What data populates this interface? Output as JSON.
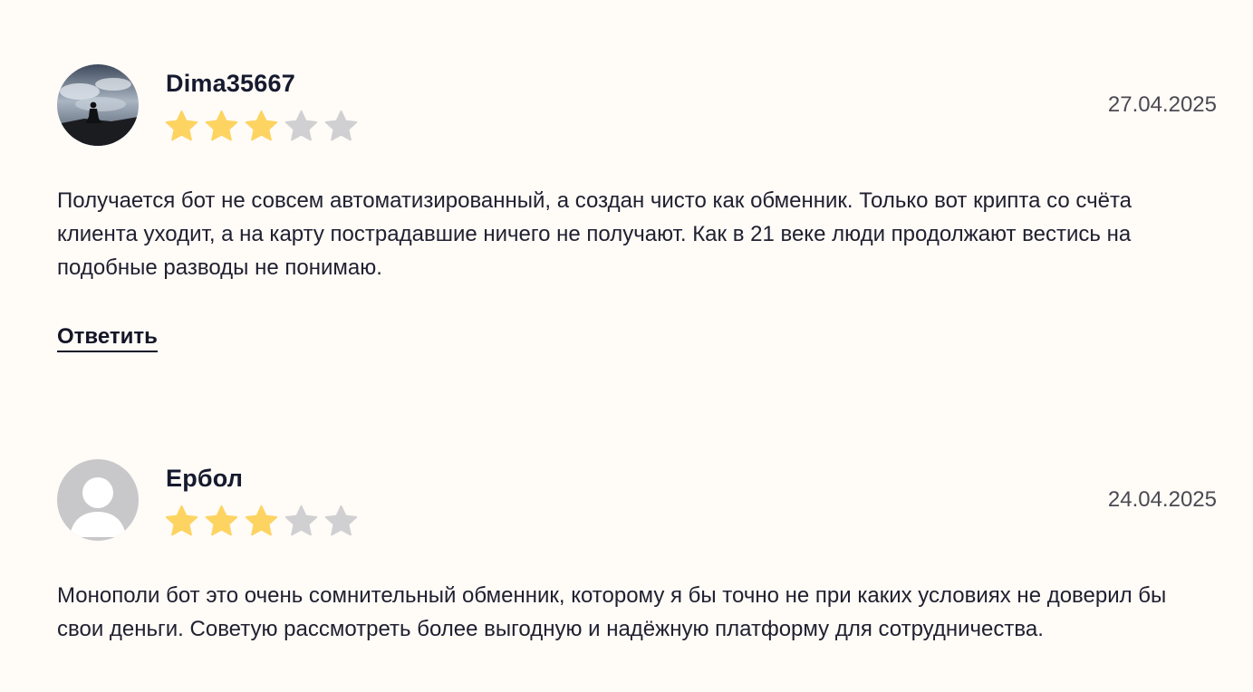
{
  "colors": {
    "background": "#fffbf7",
    "star_filled": "#fdd462",
    "star_empty": "#d0d0d2",
    "text": "#1c1c28"
  },
  "reviews": [
    {
      "author": "Dima35667",
      "rating": 3,
      "max_rating": 5,
      "date": "27.04.2025",
      "avatar_icon": "user-photo-silhouette",
      "text": "Получается бот не совсем автоматизированный, а создан чисто как обменник. Только вот крипта со счёта клиента уходит, а на карту пострадавшие ничего не получают. Как в 21 веке люди продолжают вестись на подобные разводы не понимаю.",
      "reply_label": "Ответить"
    },
    {
      "author": "Ербол",
      "rating": 3,
      "max_rating": 5,
      "date": "24.04.2025",
      "avatar_icon": "default-user-icon",
      "text": "Монополи бот это очень сомнительный обменник, которому я бы точно не при каких условиях не доверил бы свои деньги. Советую рассмотреть более выгодную и надёжную платформу для сотрудничества."
    }
  ]
}
